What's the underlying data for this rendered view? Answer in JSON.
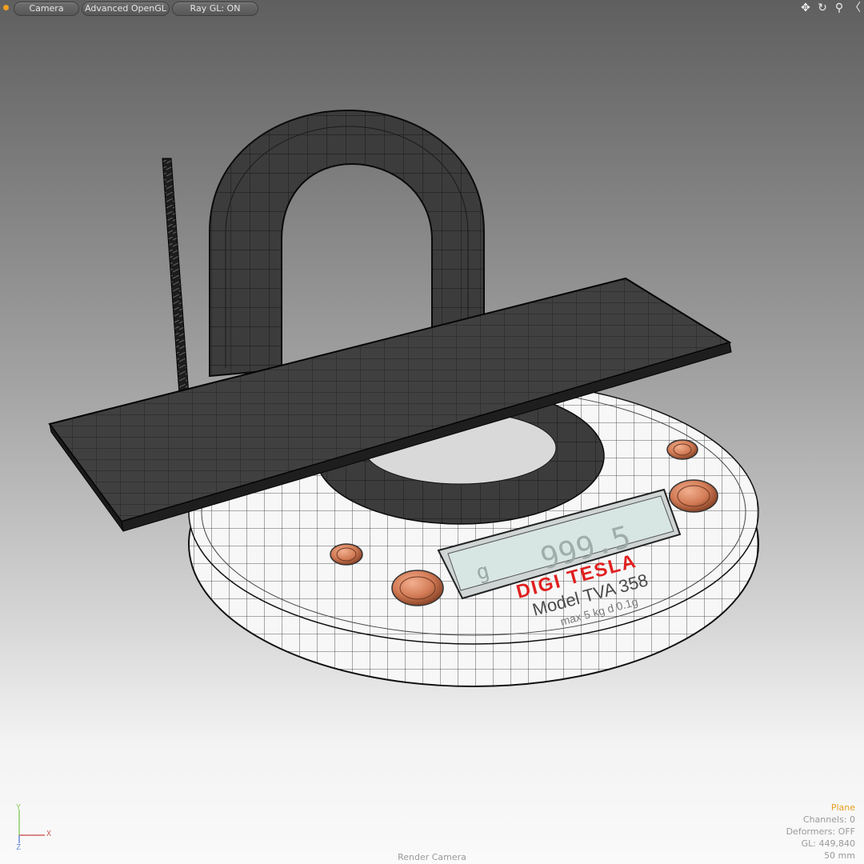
{
  "toolbar": {
    "camera_label": "Camera",
    "shading_label": "Advanced OpenGL",
    "raygl_label": "Ray GL: ON",
    "icons": [
      "move-icon",
      "rotate-icon",
      "zoom-icon",
      "maximize-icon"
    ]
  },
  "model": {
    "brand": "DIGI TESLA",
    "model_name": "Model TVA 358",
    "capacity": "max 5 kg d 0.1g",
    "display_reading": "999.5",
    "display_unit": "g",
    "brand_color": "#e02020",
    "copper_color": "#d27a55"
  },
  "info": {
    "item_name": "Plane",
    "channels": "Channels: 0",
    "deformers": "Deformers: OFF",
    "gl": "GL: 449,840",
    "focal": "50 mm"
  },
  "camera": {
    "name": "Render Camera"
  },
  "axes": {
    "y": "Y",
    "x": "X",
    "z": "Z",
    "y_color": "#8fd068",
    "x_color": "#d06060",
    "z_color": "#6a8ad8"
  },
  "colors": {
    "accent": "#f0a020",
    "item_name": "#e8a020"
  }
}
